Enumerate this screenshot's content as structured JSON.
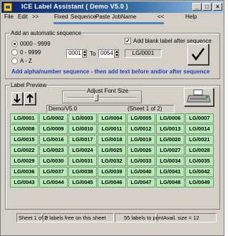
{
  "window": {
    "title": "ICE Label Assistant  ( Demo V5.0 )",
    "controls": {
      "minimize": "_",
      "maximize": "□",
      "close": "×"
    }
  },
  "menu": [
    "File",
    "Edit",
    ">>",
    "Fixed",
    "Sequence",
    "Paste",
    "JobName",
    "<<",
    "Help"
  ],
  "sequence_panel": {
    "title": "Add an automatic sequence",
    "options": [
      {
        "label": "0000 - 9999",
        "selected": true
      },
      {
        "label": "0 - 9999",
        "selected": false
      },
      {
        "label": "A - Z",
        "selected": false
      }
    ],
    "from_value": "0001",
    "to_label": "To",
    "to_value": "0054",
    "add_blank_label": "Add blank label after sequence",
    "add_blank_checked": true,
    "preview_value": "LG/0001",
    "instructions": "Add alpha/number sequence - then add text before and/or after sequence",
    "ok_icon": "checkmark-icon"
  },
  "preview_panel": {
    "title": "Label Preview",
    "font_size_label": "Adjust Font Size",
    "doc_name": "Demo/V5.0",
    "sheet_info": "(Sheet 1 of 2)",
    "down_icon": "arrow-down-icon",
    "up_icon": "arrow-up-icon",
    "print_icon": "printer-icon",
    "labels": [
      [
        "LG/0001",
        "LG/0002",
        "LG/0003",
        "LG/0004",
        "LG/0005",
        "LG/0006",
        "LG/0007"
      ],
      [
        "LG/0008",
        "LG/0009",
        "LG/0010",
        "LG/0011",
        "LG/0012",
        "LG/0013",
        "LG/0014"
      ],
      [
        "LG/0015",
        "LG/0016",
        "LG/0017",
        "LG/0018",
        "LG/0019",
        "LG/0020",
        "LG/0021"
      ],
      [
        "LG/0022",
        "LG/0023",
        "LG/0024",
        "LG/0025",
        "LG/0026",
        "LG/0027",
        "LG/0028"
      ],
      [
        "LG/0029",
        "LG/0030",
        "LG/0031",
        "LG/0032",
        "LG/0033",
        "LG/0034",
        "LG/0035"
      ],
      [
        "LG/0036",
        "LG/0037",
        "LG/0038",
        "LG/0039",
        "LG/0040",
        "LG/0041",
        "LG/0042"
      ],
      [
        "LG/0043",
        "LG/0044",
        "LG/0045",
        "LG/0046",
        "LG/0047",
        "LG/0048",
        "LG/0049"
      ]
    ],
    "label_color": "#b7eab7"
  },
  "status": {
    "sheet": "Sheet 1 of 2",
    "free": "0 labels free on this sheet",
    "to_print": "55 labels to print",
    "size": "Avail. size = 12"
  },
  "colors": {
    "titlebar": "#0a246a",
    "accent": "#4f81c7",
    "message": "#1f3fc0"
  }
}
